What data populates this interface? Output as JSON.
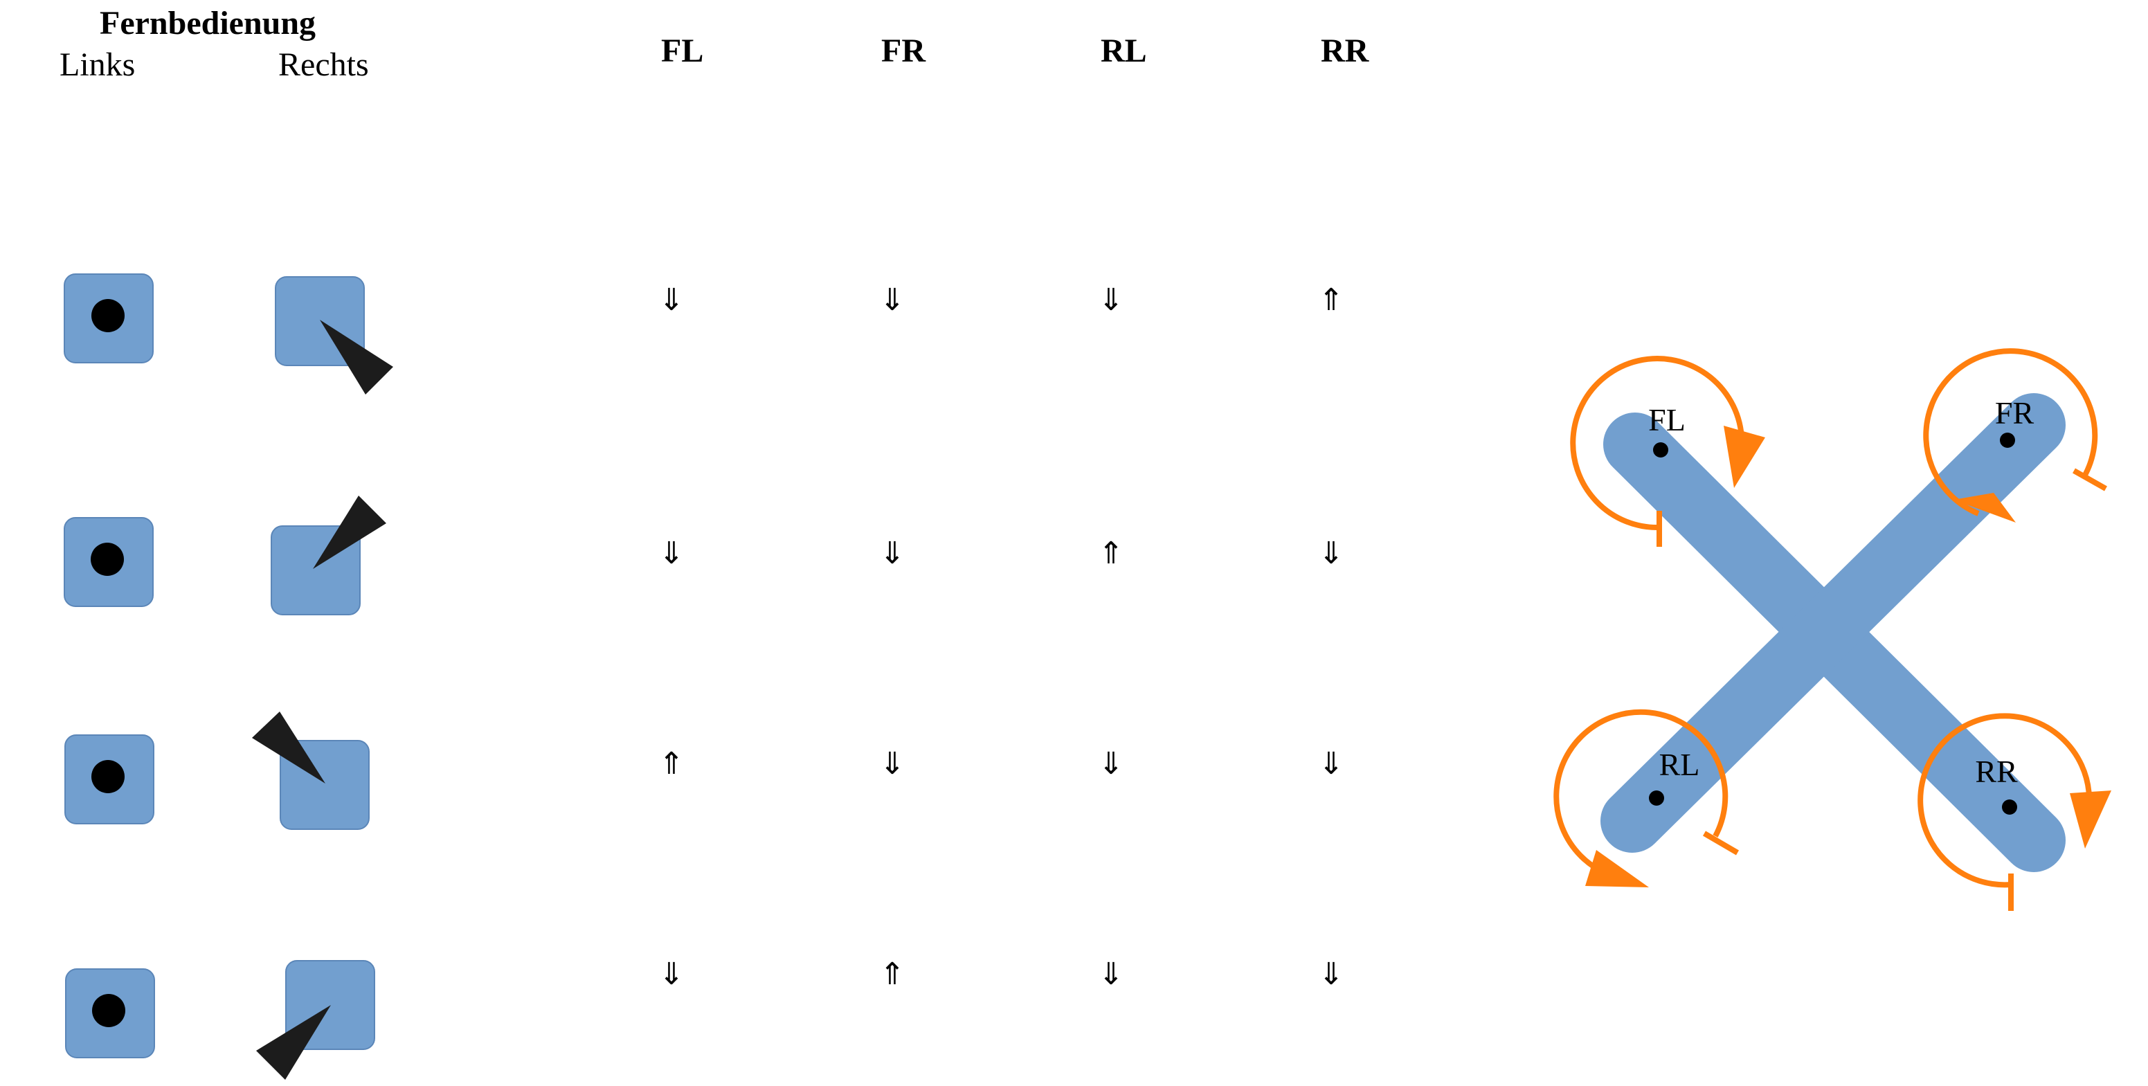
{
  "remote": {
    "title": "Fernbedienung",
    "left_label": "Links",
    "right_label": "Rechts"
  },
  "motor_headers": [
    "FL",
    "FR",
    "RL",
    "RR"
  ],
  "rows": [
    {
      "stick": "down-right",
      "arrows": [
        "⇓",
        "⇓",
        "⇓",
        "⇑"
      ]
    },
    {
      "stick": "up-right",
      "arrows": [
        "⇓",
        "⇓",
        "⇑",
        "⇓"
      ]
    },
    {
      "stick": "up-left",
      "arrows": [
        "⇑",
        "⇓",
        "⇓",
        "⇓"
      ]
    },
    {
      "stick": "down-left",
      "arrows": [
        "⇓",
        "⇑",
        "⇓",
        "⇓"
      ]
    }
  ],
  "drone": {
    "motors": [
      {
        "label": "FL",
        "rotation": "clockwise"
      },
      {
        "label": "FR",
        "rotation": "counter-clockwise"
      },
      {
        "label": "RL",
        "rotation": "counter-clockwise"
      },
      {
        "label": "RR",
        "rotation": "clockwise"
      }
    ]
  },
  "colors": {
    "stick_pad": "#729fcf",
    "drone_frame": "#729fcf",
    "rotation_arrow": "#ff7f0e",
    "stick_pointer": "#1c1c1c"
  }
}
